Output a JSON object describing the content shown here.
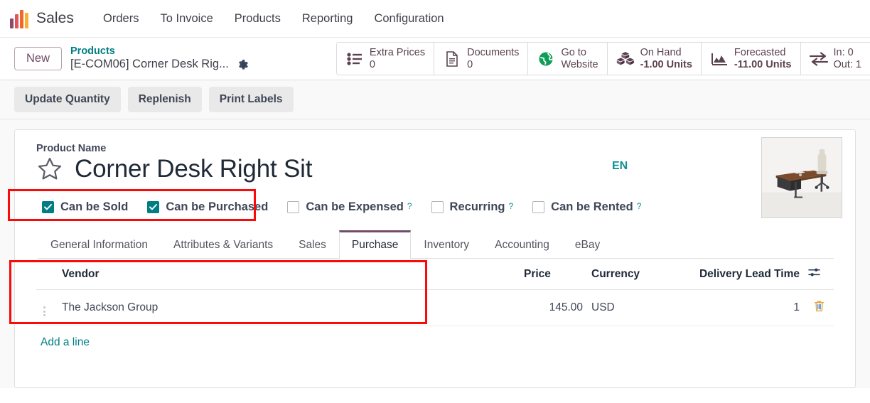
{
  "navbar": {
    "brand": "Sales",
    "logo_icon": "bar-chart-logo",
    "links": [
      {
        "label": "Orders"
      },
      {
        "label": "To Invoice"
      },
      {
        "label": "Products"
      },
      {
        "label": "Reporting"
      },
      {
        "label": "Configuration"
      }
    ]
  },
  "control_panel": {
    "new_button": "New",
    "breadcrumb_parent": "Products",
    "breadcrumb_current": "[E-COM06] Corner Desk Rig...",
    "gear_icon": "gear-icon",
    "stat_buttons": [
      {
        "icon": "list-icon",
        "label": "Extra Prices",
        "value": "0",
        "bold": false
      },
      {
        "icon": "document-icon",
        "label": "Documents",
        "value": "0",
        "bold": false
      },
      {
        "icon": "globe-icon",
        "label": "Go to",
        "value": "Website",
        "bold": false
      },
      {
        "icon": "boxes-icon",
        "label": "On Hand",
        "value": "-1.00 Units",
        "bold": true
      },
      {
        "icon": "area-chart-icon",
        "label": "Forecasted",
        "value": "-11.00 Units",
        "bold": true
      },
      {
        "icon": "exchange-icon",
        "label": "In: 0",
        "value": "Out: 1",
        "bold": false
      }
    ]
  },
  "action_buttons": [
    {
      "label": "Update Quantity"
    },
    {
      "label": "Replenish"
    },
    {
      "label": "Print Labels"
    }
  ],
  "form": {
    "product_name_label": "Product Name",
    "product_name": "Corner Desk Right Sit",
    "star_icon": "star-icon",
    "language_badge": "EN",
    "product_image_alt": "corner desk with office chair",
    "checkboxes": [
      {
        "label": "Can be Sold",
        "checked": true,
        "help": false
      },
      {
        "label": "Can be Purchased",
        "checked": true,
        "help": false
      },
      {
        "label": "Can be Expensed",
        "checked": false,
        "help": true
      },
      {
        "label": "Recurring",
        "checked": false,
        "help": true
      },
      {
        "label": "Can be Rented",
        "checked": false,
        "help": true
      }
    ],
    "help_marker": "?"
  },
  "tabs": [
    {
      "label": "General Information",
      "active": false
    },
    {
      "label": "Attributes & Variants",
      "active": false
    },
    {
      "label": "Sales",
      "active": false
    },
    {
      "label": "Purchase",
      "active": true
    },
    {
      "label": "Inventory",
      "active": false
    },
    {
      "label": "Accounting",
      "active": false
    },
    {
      "label": "eBay",
      "active": false
    }
  ],
  "vendor_table": {
    "headers": {
      "vendor": "Vendor",
      "price": "Price",
      "currency": "Currency",
      "delivery_lead_time": "Delivery Lead Time"
    },
    "optional_columns_icon": "sliders-icon",
    "rows": [
      {
        "drag_handle_icon": "drag-handle-icon",
        "vendor": "The Jackson Group",
        "price": "145.00",
        "currency": "USD",
        "delivery_lead_time": "1",
        "delete_icon": "trash-icon"
      }
    ],
    "add_line_label": "Add a line"
  },
  "colors": {
    "accent_teal": "#017e84",
    "brand_purple": "#714b67",
    "annotation_red": "#fa0a08",
    "trash_orange": "#e8a33d"
  }
}
